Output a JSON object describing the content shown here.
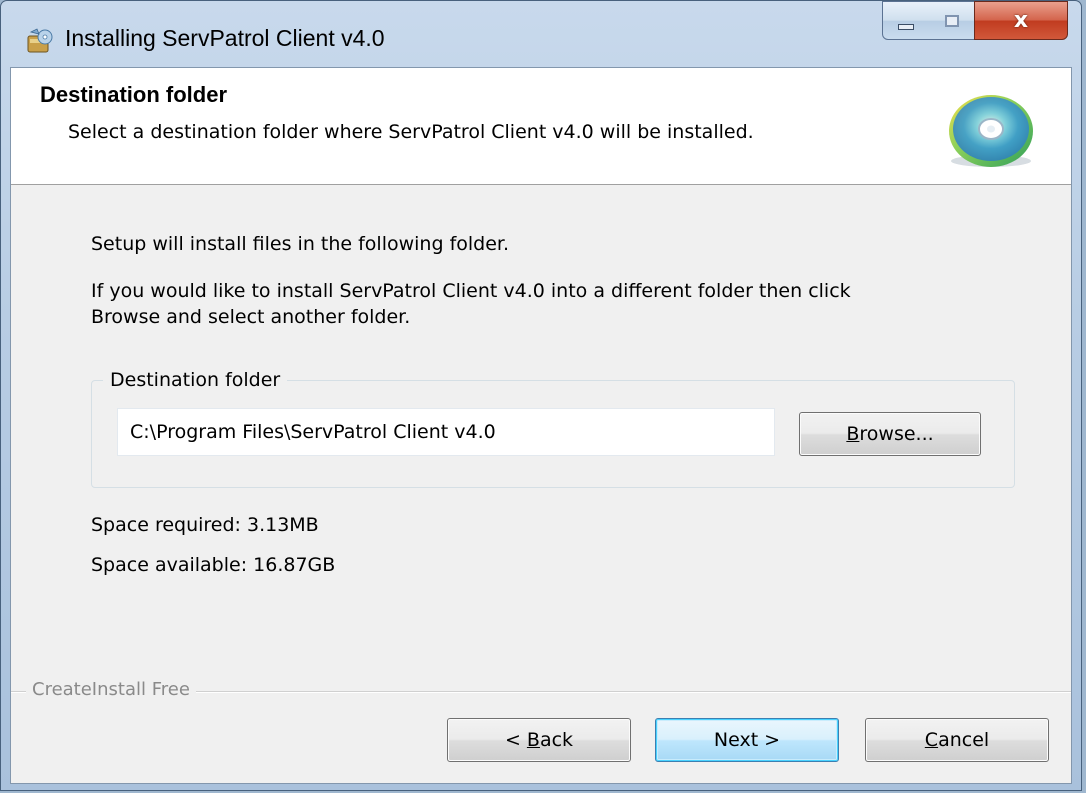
{
  "window": {
    "title": "Installing ServPatrol Client v4.0",
    "close_glyph": "x"
  },
  "header": {
    "title": "Destination folder",
    "subtitle": "Select a destination folder where ServPatrol Client v4.0 will be installed.",
    "icon": "cd-disc-icon"
  },
  "body": {
    "intro": "Setup will install files in the following folder.",
    "instruction_line1": "If you would like to install ServPatrol Client v4.0 into a different folder then click",
    "instruction_line2": "Browse and select another folder.",
    "group_label": "Destination folder",
    "path_value": "C:\\Program Files\\ServPatrol Client v4.0",
    "browse_label_prefix": "B",
    "browse_label_rest": "rowse...",
    "space_required": "Space required: 3.13MB",
    "space_available": "Space available: 16.87GB"
  },
  "footer": {
    "brand": "CreateInstall Free",
    "back_prefix": "< ",
    "back_accel": "B",
    "back_rest": "ack",
    "next_label": "Next >",
    "cancel_accel": "C",
    "cancel_rest": "ancel"
  },
  "colors": {
    "accent": "#3c7fb1",
    "close_button": "#c13c20"
  }
}
